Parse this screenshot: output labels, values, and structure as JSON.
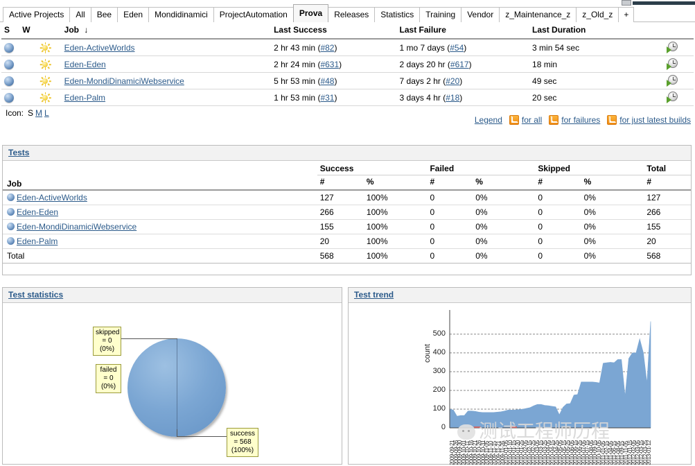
{
  "chrome": {
    "scrollbar_icon": "scrollbar-thumb"
  },
  "tabs": {
    "items": [
      {
        "label": "Active Projects",
        "active": false
      },
      {
        "label": "All",
        "active": false
      },
      {
        "label": "Bee",
        "active": false
      },
      {
        "label": "Eden",
        "active": false
      },
      {
        "label": "Mondidinamici",
        "active": false
      },
      {
        "label": "ProjectAutomation",
        "active": false
      },
      {
        "label": "Prova",
        "active": true
      },
      {
        "label": "Releases",
        "active": false
      },
      {
        "label": "Statistics",
        "active": false
      },
      {
        "label": "Training",
        "active": false
      },
      {
        "label": "Vendor",
        "active": false
      },
      {
        "label": "z_Maintenance_z",
        "active": false
      },
      {
        "label": "z_Old_z",
        "active": false
      },
      {
        "label": "+",
        "active": false
      }
    ]
  },
  "projects": {
    "headers": {
      "status": "S",
      "weather": "W",
      "job": "Job",
      "sort_indicator": "↓",
      "last_success": "Last Success",
      "last_failure": "Last Failure",
      "last_duration": "Last Duration",
      "build": ""
    },
    "rows": [
      {
        "status_icon": "blue-ball-icon",
        "weather_icon": "sunny-icon",
        "job": "Eden-ActiveWorlds",
        "last_success": "2 hr 43 min",
        "last_success_build": "#82",
        "last_failure": "1 mo 7 days",
        "last_failure_build": "#54",
        "last_duration": "3 min 54 sec",
        "build_icon": "schedule-build-icon"
      },
      {
        "status_icon": "blue-ball-icon",
        "weather_icon": "sunny-icon",
        "job": "Eden-Eden",
        "last_success": "2 hr 24 min",
        "last_success_build": "#631",
        "last_failure": "2 days 20 hr",
        "last_failure_build": "#617",
        "last_duration": "18 min",
        "build_icon": "schedule-build-icon"
      },
      {
        "status_icon": "blue-ball-icon",
        "weather_icon": "sunny-icon",
        "job": "Eden-MondiDinamiciWebservice",
        "last_success": "5 hr 53 min",
        "last_success_build": "#48",
        "last_failure": "7 days 2 hr",
        "last_failure_build": "#20",
        "last_duration": "49 sec",
        "build_icon": "schedule-build-icon"
      },
      {
        "status_icon": "blue-ball-icon",
        "weather_icon": "sunny-icon",
        "job": "Eden-Palm",
        "last_success": "1 hr 53 min",
        "last_success_build": "#31",
        "last_failure": "3 days 4 hr",
        "last_failure_build": "#18",
        "last_duration": "20 sec",
        "build_icon": "schedule-build-icon"
      }
    ]
  },
  "icon_size": {
    "label": "Icon:",
    "options": [
      "S",
      "M",
      "L"
    ],
    "selected": "S"
  },
  "feeds": {
    "legend": "Legend",
    "items": [
      {
        "icon": "rss-icon",
        "label": "for all"
      },
      {
        "icon": "rss-icon",
        "label": "for failures"
      },
      {
        "icon": "rss-icon",
        "label": "for just latest builds"
      }
    ]
  },
  "tests": {
    "title": "Tests",
    "headers": {
      "job": "Job",
      "success": "Success",
      "failed": "Failed",
      "skipped": "Skipped",
      "total": "Total",
      "count_symbol": "#",
      "percent_symbol": "%"
    },
    "rows": [
      {
        "job": "Eden-ActiveWorlds",
        "success_n": "127",
        "success_p": "100%",
        "failed_n": "0",
        "failed_p": "0%",
        "skipped_n": "0",
        "skipped_p": "0%",
        "total_n": "127",
        "icon": "blue-ball-icon"
      },
      {
        "job": "Eden-Eden",
        "success_n": "266",
        "success_p": "100%",
        "failed_n": "0",
        "failed_p": "0%",
        "skipped_n": "0",
        "skipped_p": "0%",
        "total_n": "266",
        "icon": "blue-ball-icon"
      },
      {
        "job": "Eden-MondiDinamiciWebservice",
        "success_n": "155",
        "success_p": "100%",
        "failed_n": "0",
        "failed_p": "0%",
        "skipped_n": "0",
        "skipped_p": "0%",
        "total_n": "155",
        "icon": "blue-ball-icon"
      },
      {
        "job": "Eden-Palm",
        "success_n": "20",
        "success_p": "100%",
        "failed_n": "0",
        "failed_p": "0%",
        "skipped_n": "0",
        "skipped_p": "0%",
        "total_n": "20",
        "icon": "blue-ball-icon"
      }
    ],
    "total_row": {
      "job": "Total",
      "success_n": "568",
      "success_p": "100%",
      "failed_n": "0",
      "failed_p": "0%",
      "skipped_n": "0",
      "skipped_p": "0%",
      "total_n": "568"
    }
  },
  "test_statistics": {
    "title": "Test statistics"
  },
  "test_trend": {
    "title": "Test trend"
  },
  "watermark": {
    "text": "测试工程师历程"
  },
  "colors": {
    "accent_blue": "#7ba6d3",
    "link": "#2b5a8a",
    "callout_bg": "#ffffcc",
    "callout_border": "#9a9a3a",
    "rss_orange": "#ef8b12",
    "panel_border": "#bbbbbb"
  },
  "chart_data": [
    {
      "type": "pie",
      "title": "Test statistics",
      "labels": [
        "skipped",
        "failed",
        "success"
      ],
      "values": [
        0,
        0,
        568
      ],
      "percents": [
        "0%",
        "0%",
        "100%"
      ],
      "callouts": [
        {
          "name": "skipped",
          "value_text": "= 0",
          "percent_text": "(0%)"
        },
        {
          "name": "failed",
          "value_text": "= 0",
          "percent_text": "(0%)"
        },
        {
          "name": "success",
          "value_text": "= 568",
          "percent_text": "(100%)"
        }
      ],
      "colors": [
        "#7ba6d3",
        "#7ba6d3",
        "#7ba6d3"
      ],
      "legend": "none"
    },
    {
      "type": "area",
      "title": "Test trend",
      "ylabel": "count",
      "xlabel": "",
      "ylim": [
        0,
        570
      ],
      "yticks": [
        0,
        100,
        200,
        300,
        400,
        500
      ],
      "grid": true,
      "legend": "none",
      "x": [
        "2009-09-21",
        "2009-09-26",
        "2009-09-30",
        "2009-10-01",
        "2009-10-11",
        "2009-10-16",
        "2009-10-21",
        "2009-10-26",
        "2009-10-31",
        "2009-11-05",
        "2009-11-10",
        "2009-11-15",
        "2009-11-21",
        "2009-11-26",
        "2010-01-05",
        "2010-01-10",
        "2010-01-15",
        "2010-01-20",
        "2010-01-25",
        "2010-02-05",
        "2010-02-15",
        "2010-02-25",
        "2010-03-05",
        "2010-03-15",
        "2010-03-25",
        "2010-04-05",
        "2010-04-15",
        "2010-04-25",
        "2010-05-05",
        "2010-05-15",
        "2010-05-25",
        "2010-06-05",
        "2010-06-15",
        "2010-06-25",
        "2010-07-05",
        "2010-07-15",
        "2010-08-05",
        "2010-09-15",
        "2010-10-05",
        "2011-01-05",
        "2011-02-15",
        "2011-04-05",
        "2011-06-15",
        "2011-08-05",
        "2011-09-15",
        "2011-11-05",
        "2012-01-15",
        "2012-02-05",
        "2012-03-05",
        "2012-03-15",
        "2012-03-25",
        "2013-01-12"
      ],
      "series": [
        {
          "name": "count",
          "values": [
            100,
            95,
            62,
            66,
            66,
            90,
            90,
            88,
            84,
            82,
            82,
            82,
            82,
            84,
            86,
            90,
            95,
            95,
            96,
            98,
            100,
            104,
            108,
            118,
            125,
            125,
            120,
            118,
            115,
            112,
            70,
            110,
            128,
            130,
            175,
            178,
            245,
            245,
            245,
            245,
            243,
            240,
            345,
            348,
            350,
            348,
            365,
            365,
            170,
            370,
            400,
            400,
            475,
            400,
            240,
            568
          ]
        }
      ]
    }
  ]
}
